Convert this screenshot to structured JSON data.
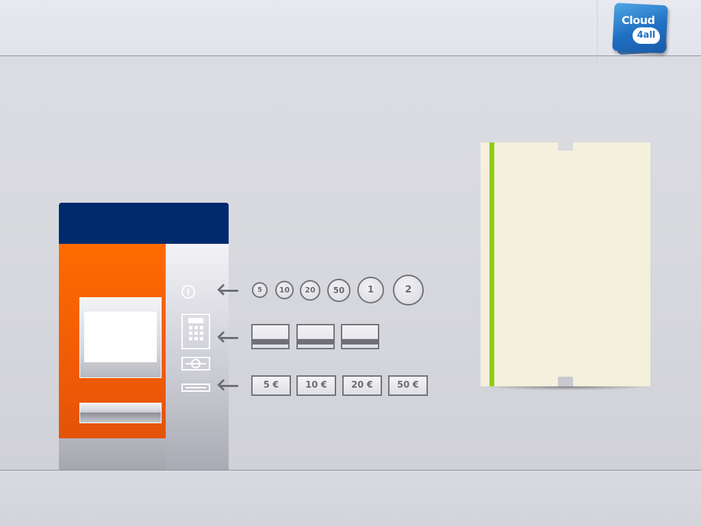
{
  "logo": {
    "brand": "Cloud",
    "sub": "4all"
  },
  "coins": [
    "5",
    "10",
    "20",
    "50",
    "1",
    "2"
  ],
  "cards": [
    {
      "id": "card-1"
    },
    {
      "id": "card-2"
    },
    {
      "id": "card-3"
    }
  ],
  "banknotes": [
    "5 €",
    "10 €",
    "20 €",
    "50 €"
  ],
  "colors": {
    "machine_header": "#002a6e",
    "machine_front": "#ff6a00",
    "ticket_stripe": "#8ccf0e",
    "ticket_paper": "#f5f0dc",
    "logo_blue": "#1f6fc2"
  },
  "icons": {
    "coin_slot": "coin-slot-icon",
    "keypad": "keypad-icon",
    "card_slot": "card-slot-icon",
    "note_slot": "banknote-slot-icon",
    "arrow": "arrow-left-icon"
  }
}
